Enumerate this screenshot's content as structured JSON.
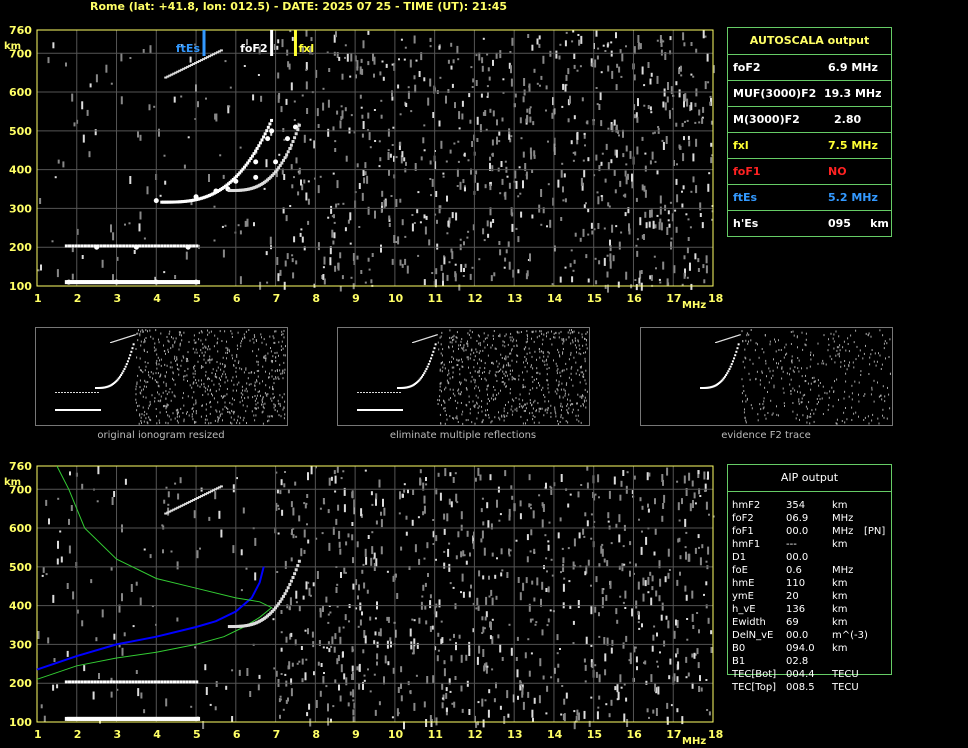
{
  "header": "Rome (lat: +41.8, lon: 012.5) - DATE: 2025 07 25 - TIME (UT): 21:45",
  "axis": {
    "y_ticks": [
      "760",
      "700",
      "600",
      "500",
      "400",
      "300",
      "200",
      "100"
    ],
    "y_unit": "km",
    "x_ticks": [
      "1",
      "2",
      "3",
      "4",
      "5",
      "6",
      "7",
      "8",
      "9",
      "10",
      "11",
      "12",
      "13",
      "14",
      "15",
      "16",
      "17",
      "18"
    ],
    "x_unit": "MHz"
  },
  "markers": [
    {
      "label": "ftEs",
      "freq": 5.2,
      "color": "#3399ff"
    },
    {
      "label": "foF2",
      "freq": 6.9,
      "color": "#ffffff"
    },
    {
      "label": "fxl",
      "freq": 7.5,
      "color": "#ffff33"
    }
  ],
  "autoscala": {
    "title": "AUTOSCALA output",
    "rows": [
      {
        "label": "foF2",
        "value": "6.9 MHz",
        "color": "#ffffff"
      },
      {
        "label": "MUF(3000)F2",
        "value": "19.3 MHz",
        "color": "#ffffff"
      },
      {
        "label": "M(3000)F2",
        "value": "2.80",
        "color": "#ffffff"
      },
      {
        "label": "fxl",
        "value": "7.5 MHz",
        "color": "#ffff33"
      },
      {
        "label": "foF1",
        "value": "NO",
        "color": "#ff2222"
      },
      {
        "label": "ftEs",
        "value": "5.2 MHz",
        "color": "#3399ff"
      },
      {
        "label": "h'Es",
        "value": "095     km",
        "color": "#ffffff"
      }
    ]
  },
  "thumb_captions": [
    "original ionogram resized",
    "eliminate multiple reflections",
    "evidence F2 trace"
  ],
  "aip": {
    "title": "AIP output",
    "rows": [
      [
        "hmF2",
        "354",
        "km",
        ""
      ],
      [
        "foF2",
        "06.9",
        "MHz",
        ""
      ],
      [
        "foF1",
        "00.0",
        "MHz",
        "[PN]"
      ],
      [
        "hmF1",
        "---",
        "km",
        ""
      ],
      [
        "D1",
        "00.0",
        "",
        ""
      ],
      [
        "foE",
        "0.6",
        "MHz",
        ""
      ],
      [
        "hmE",
        "110",
        "km",
        ""
      ],
      [
        "ymE",
        "20",
        "km",
        ""
      ],
      [
        "h_vE",
        "136",
        "km",
        ""
      ],
      [
        "Ewidth",
        "69",
        "km",
        ""
      ],
      [
        "DelN_vE",
        "00.0",
        "m^(-3)",
        ""
      ],
      [
        "B0",
        "094.0",
        "km",
        ""
      ],
      [
        "B1",
        "02.8",
        "",
        ""
      ],
      [
        "TEC[Bot]",
        "004.4",
        "TECU",
        ""
      ],
      [
        "TEC[Top]",
        "008.5",
        "TECU",
        ""
      ]
    ]
  },
  "chart_data": [
    {
      "type": "scatter",
      "title": "Rome (lat: +41.8, lon: 012.5) - DATE: 2025 07 25 - TIME (UT): 21:45",
      "xlabel": "MHz",
      "ylabel": "km",
      "xlim": [
        1,
        18
      ],
      "ylim": [
        100,
        760
      ],
      "grid": true,
      "series": [
        {
          "name": "Es trace",
          "points": [
            [
              1.8,
              110
            ],
            [
              3,
              110
            ],
            [
              4,
              110
            ],
            [
              5,
              110
            ],
            [
              2.5,
              200
            ],
            [
              3.5,
              200
            ],
            [
              4.8,
              200
            ]
          ]
        },
        {
          "name": "F2 trace",
          "points": [
            [
              4,
              320
            ],
            [
              5,
              330
            ],
            [
              5.5,
              345
            ],
            [
              6,
              370
            ],
            [
              6.5,
              420
            ],
            [
              6.8,
              480
            ],
            [
              6.9,
              500
            ]
          ]
        },
        {
          "name": "F2 x-trace",
          "points": [
            [
              5.8,
              350
            ],
            [
              6.5,
              380
            ],
            [
              7,
              420
            ],
            [
              7.3,
              480
            ],
            [
              7.5,
              510
            ]
          ]
        }
      ],
      "vlines": [
        5.2,
        6.9,
        7.5
      ]
    },
    {
      "type": "line",
      "xlabel": "MHz",
      "ylabel": "km",
      "xlim": [
        1,
        18
      ],
      "ylim": [
        100,
        760
      ],
      "grid": true,
      "series": [
        {
          "name": "",
          "color": "#0000ff",
          "points": [
            [
              1,
              235
            ],
            [
              2,
              270
            ],
            [
              3,
              300
            ],
            [
              4,
              320
            ],
            [
              5,
              345
            ],
            [
              5.5,
              360
            ],
            [
              6,
              385
            ],
            [
              6.4,
              420
            ],
            [
              6.6,
              460
            ],
            [
              6.7,
              500
            ]
          ]
        },
        {
          "name": "",
          "color": "#33cc33",
          "points": [
            [
              1,
              210
            ],
            [
              2,
              245
            ],
            [
              3,
              265
            ],
            [
              4,
              280
            ],
            [
              5,
              300
            ],
            [
              5.7,
              320
            ],
            [
              6.2,
              345
            ],
            [
              6.6,
              370
            ],
            [
              6.9,
              395
            ],
            [
              6.6,
              410
            ],
            [
              6,
              420
            ],
            [
              5,
              445
            ],
            [
              4,
              470
            ],
            [
              3,
              520
            ],
            [
              2.2,
              600
            ],
            [
              1.8,
              700
            ],
            [
              1.5,
              760
            ]
          ]
        }
      ]
    }
  ]
}
